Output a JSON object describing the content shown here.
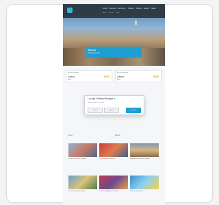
{
  "colors": {
    "page_bg": "#f3f3f4",
    "topbar": "#2f3b46",
    "accent": "#1f9fd1",
    "brand_gold": "#d4a21c"
  },
  "header": {
    "nav_items": [
      "Home",
      "Services",
      "Economy",
      "Tourism",
      "Culture",
      "Events",
      "News"
    ],
    "sub_items": [
      "About",
      "Contact",
      "Login"
    ]
  },
  "hero": {
    "title": "Welcome",
    "subtitle": "Discover the city"
  },
  "info_cards": [
    {
      "small": "Account balance",
      "amount": "1,234 €",
      "logo": "ESS",
      "link": "More"
    },
    {
      "small": "Account balance",
      "amount": "1,234 €",
      "logo": "ESS",
      "link": "More"
    }
  ],
  "modal": {
    "title": "Locally Defined Budget",
    "star": "★",
    "field_hint": "Please choose an option",
    "buttons": [
      "Cancel",
      "Options",
      "Confirm"
    ]
  },
  "sections": {
    "left": "News",
    "right": "Events"
  },
  "tiles": [
    {
      "caption": "Local news article headline"
    },
    {
      "caption": "City festival and market"
    },
    {
      "caption": "Regional development update"
    },
    {
      "caption": "Community sports report"
    },
    {
      "caption": "Cultural highlights this week"
    },
    {
      "caption": "Tourism information"
    }
  ]
}
